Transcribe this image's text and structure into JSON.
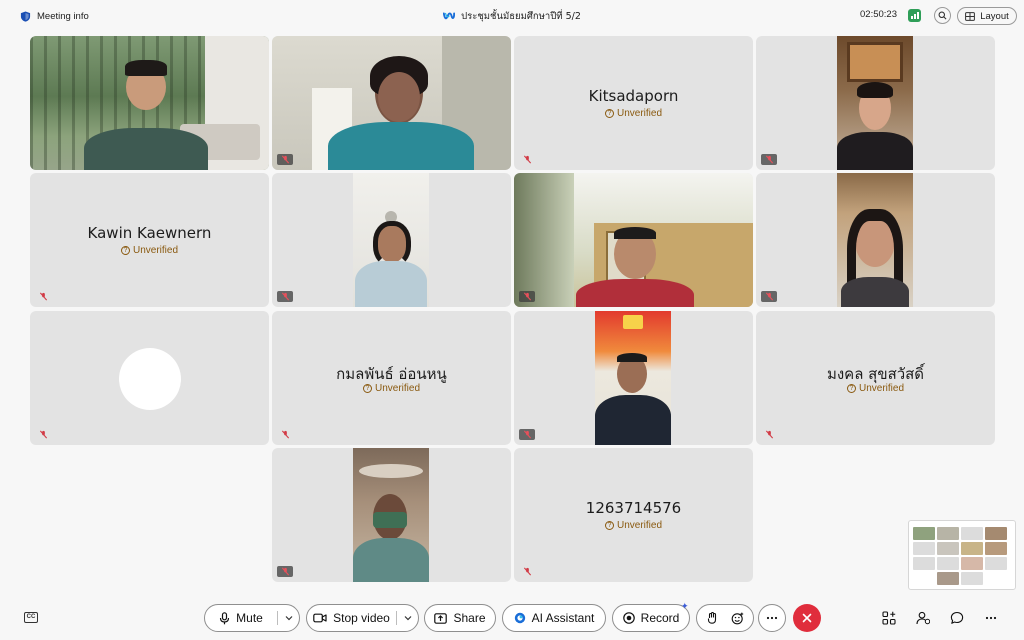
{
  "header": {
    "meeting_info_label": "Meeting info",
    "meeting_title": "ประชุมชั้นมัธยมศึกษาปีที่ 5/2",
    "clock": "02:50:23",
    "layout_label": "Layout"
  },
  "participants": [
    {
      "name": "",
      "type": "video"
    },
    {
      "name": "",
      "type": "video"
    },
    {
      "name": "Kitsadaporn",
      "status": "Unverified",
      "type": "name"
    },
    {
      "name": "",
      "type": "video"
    },
    {
      "name": "Kawin Kaewnern",
      "status": "Unverified",
      "type": "name"
    },
    {
      "name": "",
      "type": "video"
    },
    {
      "name": "",
      "type": "video"
    },
    {
      "name": "",
      "type": "video"
    },
    {
      "name": "",
      "type": "avatar"
    },
    {
      "name": "กมลพันธ์ อ่อนหนู",
      "status": "Unverified",
      "type": "name"
    },
    {
      "name": "",
      "type": "video"
    },
    {
      "name": "มงคล สุขสวัสดิ์",
      "status": "Unverified",
      "type": "name"
    },
    {
      "name": "",
      "type": "video"
    },
    {
      "name": "1263714576",
      "status": "Unverified",
      "type": "name"
    }
  ],
  "toolbar": {
    "mute_label": "Mute",
    "stop_video_label": "Stop video",
    "share_label": "Share",
    "ai_assistant_label": "AI Assistant",
    "record_label": "Record",
    "cc_label": "CC"
  },
  "icons": {
    "meeting_info": "shield-icon",
    "title": "webex-logo-icon",
    "signal": "signal-bars-icon",
    "zoom": "magnifier-icon",
    "layout": "grid-layout-icon",
    "muted": "mic-off-icon",
    "leave": "close-icon"
  },
  "colors": {
    "accent_blue": "#1a6ed8",
    "leave_red": "#e02d3c",
    "unverified": "#8a5a10",
    "signal_green": "#2f9e58"
  }
}
